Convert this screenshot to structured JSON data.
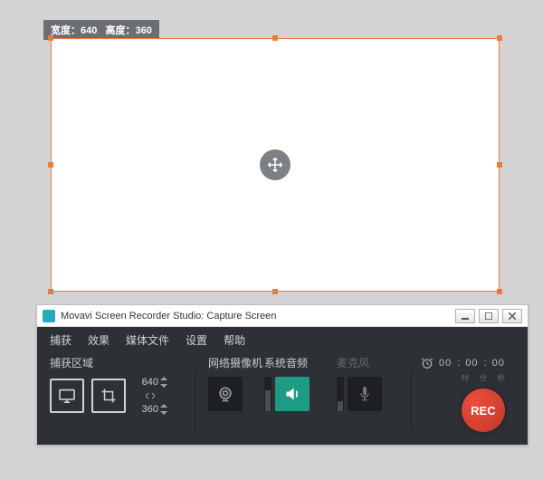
{
  "capture": {
    "width_label": "宽度：",
    "height_label": "高度：",
    "width": "640",
    "height": "360"
  },
  "window": {
    "title": "Movavi Screen Recorder Studio: Capture Screen"
  },
  "menu": {
    "capture": "捕获",
    "effects": "效果",
    "media": "媒体文件",
    "settings": "设置",
    "help": "帮助"
  },
  "groups": {
    "capture_area": "捕获区域",
    "webcam": "网络摄像机",
    "system_audio": "系统音频",
    "microphone": "麦克风"
  },
  "steppers": {
    "width": "640",
    "height": "360"
  },
  "timer": {
    "hh": "00",
    "mm": "00",
    "ss": "00",
    "hh_u": "时",
    "mm_u": "分",
    "ss_u": "秒"
  },
  "rec": {
    "label": "REC"
  },
  "colors": {
    "accent": "#e87c3c",
    "rec": "#e74c3c",
    "audio_on": "#1e9b84"
  }
}
